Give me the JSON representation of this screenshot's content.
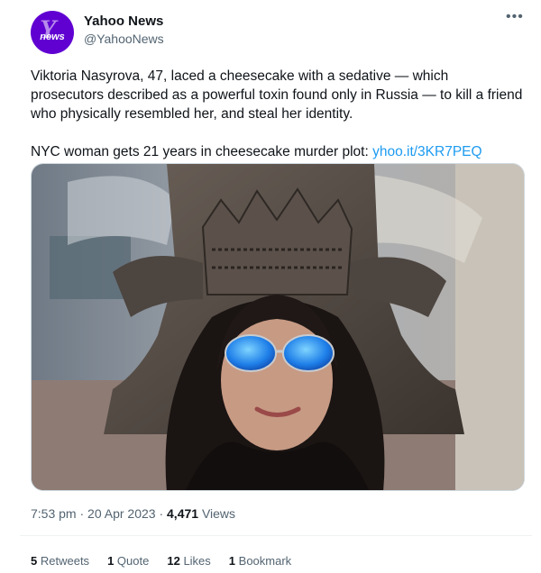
{
  "account": {
    "name": "Yahoo News",
    "handle": "@YahooNews",
    "avatar_text": "news",
    "brand_color": "#6001d2"
  },
  "more_icon": "more-horizontal-icon",
  "tweet": {
    "paragraph1": "Viktoria Nasyrova, 47, laced a cheesecake with a sedative — which prosecutors described as a powerful toxin found only in Russia — to kill a friend who physically resembled her, and steal her identity.",
    "paragraph2_text": "NYC woman gets 21 years in cheesecake murder plot: ",
    "paragraph2_link": "yhoo.it/3KR7PEQ",
    "link_color": "#1d9bf0"
  },
  "meta": {
    "time": "7:53 pm",
    "date": "20 Apr 2023",
    "views_count": "4,471",
    "views_label": "Views"
  },
  "stats": {
    "retweets_count": "5",
    "retweets_label": "Retweets",
    "quotes_count": "1",
    "quotes_label": "Quote",
    "likes_count": "12",
    "likes_label": "Likes",
    "bookmarks_count": "1",
    "bookmarks_label": "Bookmark"
  }
}
